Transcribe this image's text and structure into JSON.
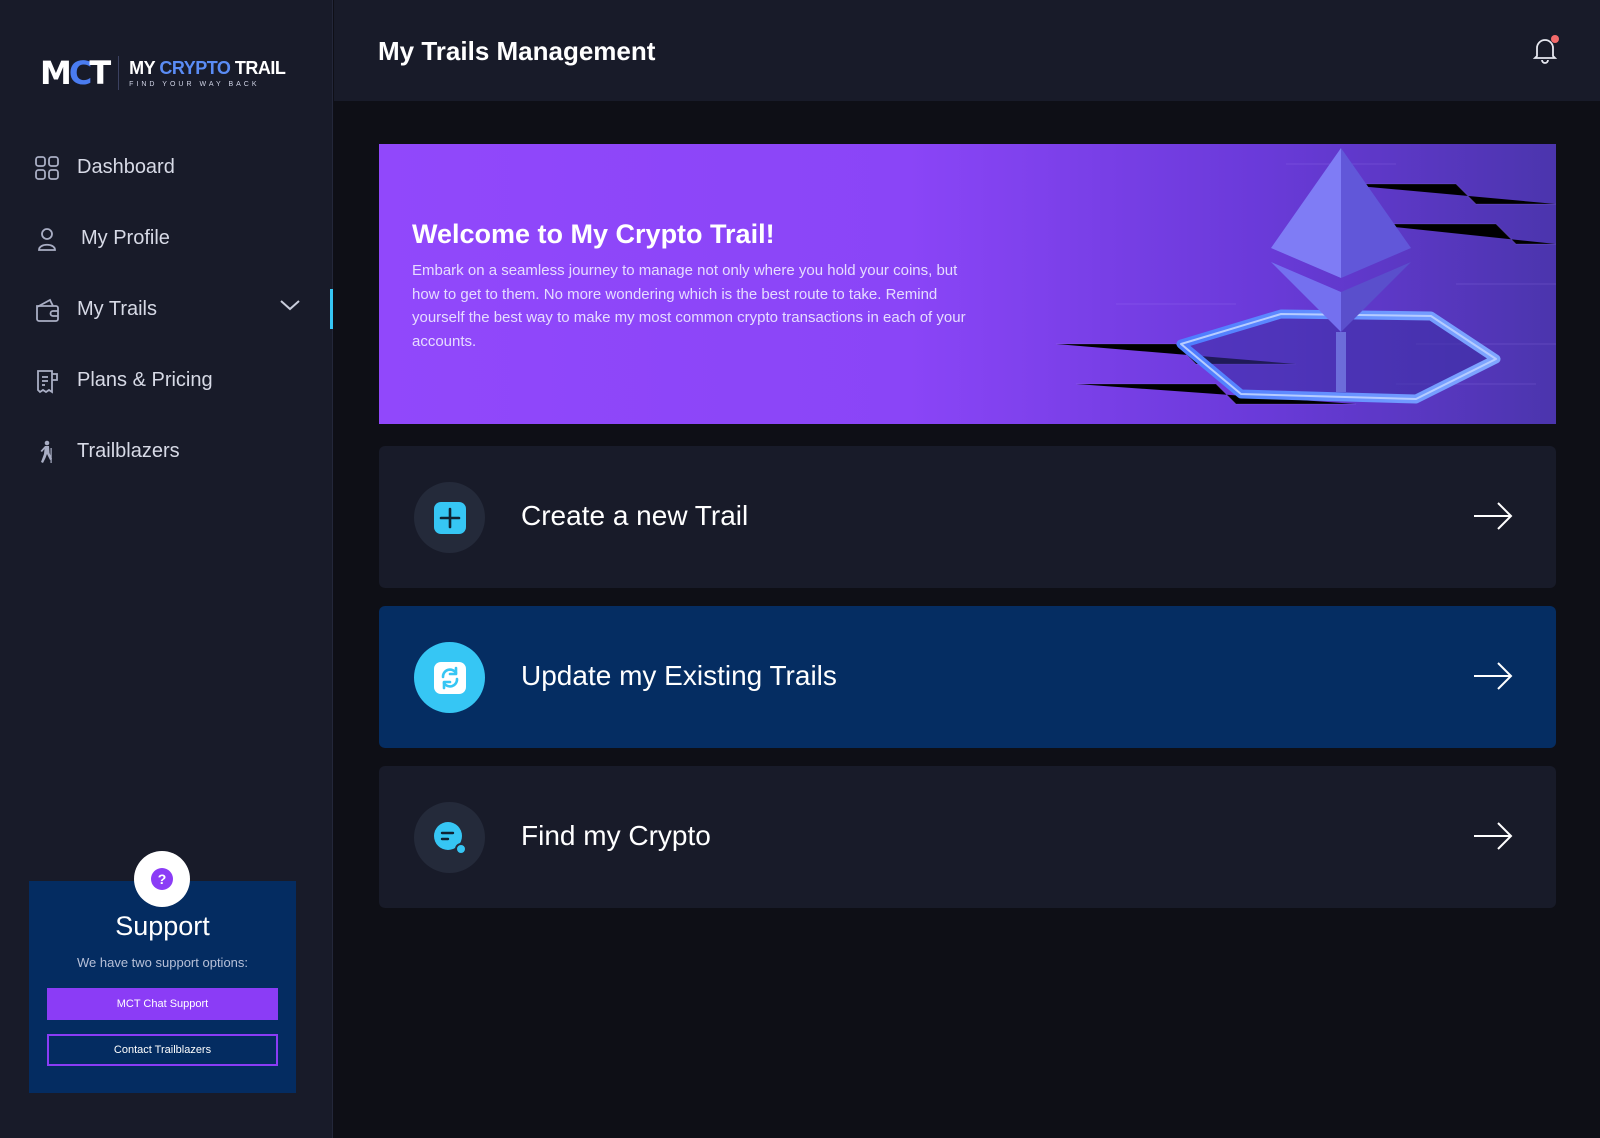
{
  "brand": {
    "mark": "MCT",
    "name_part1": "MY",
    "name_part2": "CRYPTO",
    "name_part3": "TRAIL",
    "tagline": "FIND YOUR WAY BACK"
  },
  "sidebar": {
    "items": [
      {
        "label": "Dashboard",
        "icon": "grid-icon"
      },
      {
        "label": "My Profile",
        "icon": "user-icon"
      },
      {
        "label": "My Trails",
        "icon": "wallet-icon",
        "active": true
      },
      {
        "label": "Plans & Pricing",
        "icon": "receipt-icon"
      },
      {
        "label": "Trailblazers",
        "icon": "hiker-icon"
      }
    ]
  },
  "support": {
    "title": "Support",
    "subtitle": "We have two support options:",
    "chat_button": "MCT Chat Support",
    "contact_button": "Contact Trailblazers"
  },
  "header": {
    "title": "My Trails Management"
  },
  "banner": {
    "title": "Welcome to My Crypto Trail!",
    "text": "Embark on a seamless journey to manage not only where you hold your coins, but how to get to them. No more wondering which is the best route to take. Remind yourself the best way to make my most common crypto transactions in each of your accounts."
  },
  "cards": [
    {
      "label": "Create a new Trail",
      "icon": "plus-icon"
    },
    {
      "label": "Update my Existing Trails",
      "icon": "refresh-icon"
    },
    {
      "label": "Find my Crypto",
      "icon": "chat-search-icon"
    }
  ],
  "colors": {
    "accent_purple": "#8b3cf6",
    "accent_cyan": "#36c6f4",
    "navy": "#052d62",
    "sidebar_bg": "#181b29",
    "page_bg": "#0e0f16"
  }
}
